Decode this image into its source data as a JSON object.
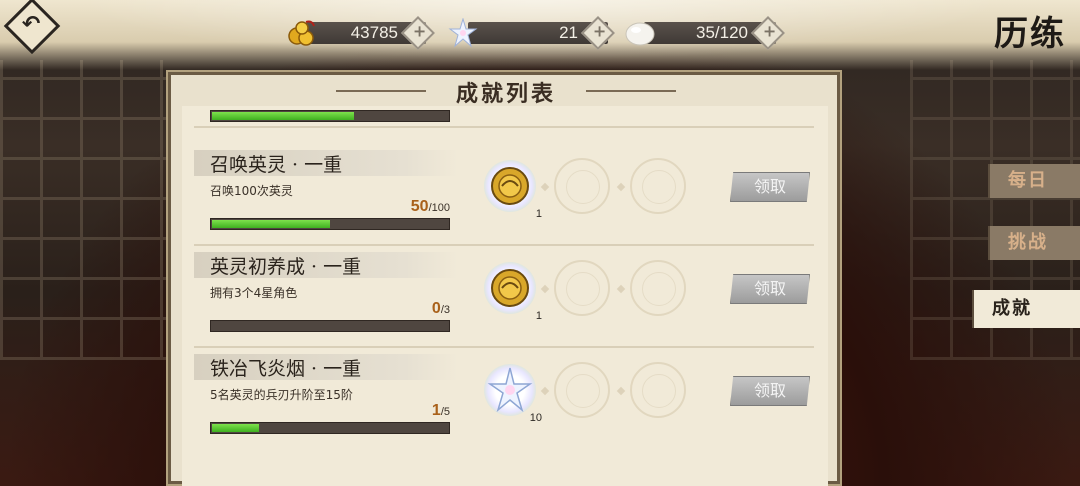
{
  "header": {
    "page_title": "历练",
    "currencies": [
      {
        "icon": "gold-coin-icon",
        "value": "43785"
      },
      {
        "icon": "star-crystal-icon",
        "value": "21"
      },
      {
        "icon": "stamina-stone-icon",
        "value": "35/120"
      }
    ]
  },
  "panel": {
    "title": "成就列表",
    "achievements": [
      {
        "name": "召唤英灵 · 一重",
        "desc": "召唤100次英灵",
        "current": "50",
        "max": "/100",
        "progress": 0.5,
        "reward_icon": "gold-medal-icon",
        "reward_count": "1",
        "claim_label": "领取"
      },
      {
        "name": "英灵初养成 · 一重",
        "desc": "拥有3个4星角色",
        "current": "0",
        "max": "/3",
        "progress": 0.0,
        "reward_icon": "gold-medal-icon",
        "reward_count": "1",
        "claim_label": "领取"
      },
      {
        "name": "铁冶飞炎烟 · 一重",
        "desc": "5名英灵的兵刃升阶至15阶",
        "current": "1",
        "max": "/5",
        "progress": 0.2,
        "reward_icon": "star-crystal-icon",
        "reward_count": "10",
        "claim_label": "领取"
      }
    ],
    "partial_row_progress": 0.6
  },
  "tabs": [
    {
      "label": "每日",
      "active": false
    },
    {
      "label": "挑战",
      "active": false
    },
    {
      "label": "成就",
      "active": true
    }
  ]
}
